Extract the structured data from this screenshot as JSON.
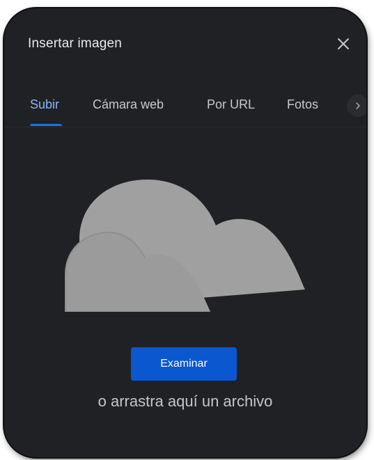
{
  "dialog": {
    "title": "Insertar imagen",
    "close_icon": "close-icon"
  },
  "tabs": [
    {
      "label": "Subir",
      "active": true
    },
    {
      "label": "Cámara web",
      "active": false
    },
    {
      "label": "Por URL",
      "active": false
    },
    {
      "label": "Fotos",
      "active": false
    }
  ],
  "tabs_scroll_icon": "chevron-right-icon",
  "upload": {
    "illustration_icon": "cloud-illustration",
    "browse_label": "Examinar",
    "drop_hint": "o arrastra aquí un archivo"
  },
  "colors": {
    "background": "#202124",
    "accent": "#1a73e8",
    "active_tab_text": "#8ab4f8",
    "button": "#0b57d0"
  }
}
